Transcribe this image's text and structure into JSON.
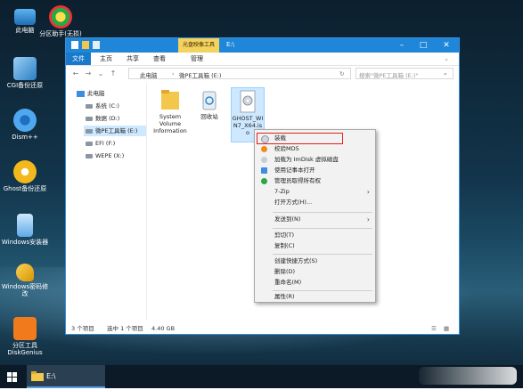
{
  "desktop": {
    "icons": [
      {
        "label": "此电脑",
        "icon": "computer-icon"
      },
      {
        "label": "分区助手(无损)",
        "icon": "partition-assistant-icon"
      },
      {
        "label": "CGI备份还原",
        "icon": "cgi-backup-icon"
      },
      {
        "label": "Dism++",
        "icon": "dism-gear-icon"
      },
      {
        "label": "Ghost备份还原",
        "icon": "ghost-icon"
      },
      {
        "label": "Windows安装器",
        "icon": "windows-installer-icon"
      },
      {
        "label": "Windows密码修改",
        "icon": "key-icon"
      },
      {
        "label": "分区工具DiskGenius",
        "icon": "diskgenius-icon"
      }
    ]
  },
  "taskbar": {
    "explorer_label": "E:\\"
  },
  "window": {
    "title": "E:\\",
    "context_tab": "光盘映像工具",
    "ribbon_tabs": [
      "文件",
      "主页",
      "共享",
      "查看",
      "管理"
    ],
    "address": {
      "root": "此电脑",
      "current": "微PE工具箱 (E:)"
    },
    "search_placeholder": "搜索\"微PE工具箱 (E:)\"",
    "nav": [
      {
        "label": "此电脑",
        "icon": "computer-icon"
      },
      {
        "label": "系统 (C:)",
        "icon": "drive-icon"
      },
      {
        "label": "数据 (D:)",
        "icon": "drive-icon"
      },
      {
        "label": "微PE工具箱 (E:)",
        "icon": "drive-icon"
      },
      {
        "label": "EFI (F:)",
        "icon": "drive-icon"
      },
      {
        "label": "WEPE (X:)",
        "icon": "drive-icon"
      }
    ],
    "files": [
      {
        "name": "System Volume Information",
        "icon": "folder-icon"
      },
      {
        "name": "回收站",
        "icon": "recycle-bin-icon"
      },
      {
        "name": "GHOST_WIN7_X64.iso",
        "icon": "disc-image-icon"
      }
    ],
    "status": {
      "count": "3 个项目",
      "selected": "选中 1 个项目",
      "size": "4.40 GB"
    }
  },
  "context_menu": {
    "items": [
      {
        "label": "装载",
        "icon": "disc-icon"
      },
      {
        "label": "校验MD5",
        "icon": "md5-icon"
      },
      {
        "label": "加载为 ImDisk 虚拟磁盘",
        "icon": "imdisk-icon"
      },
      {
        "label": "使用记事本打开",
        "icon": "notepad-icon"
      },
      {
        "label": "管理员取得所有权",
        "icon": "shield-icon"
      },
      {
        "label": "7-Zip",
        "icon": ""
      },
      {
        "label": "打开方式(H)...",
        "icon": ""
      },
      {
        "label": "发送到(N)",
        "icon": ""
      },
      {
        "label": "剪切(T)",
        "icon": ""
      },
      {
        "label": "复制(C)",
        "icon": ""
      },
      {
        "label": "创建快捷方式(S)",
        "icon": ""
      },
      {
        "label": "删除(D)",
        "icon": ""
      },
      {
        "label": "重命名(M)",
        "icon": ""
      },
      {
        "label": "属性(R)",
        "icon": ""
      }
    ]
  },
  "colors": {
    "accent": "#1f86da",
    "highlight_border": "#e02020",
    "context_tab": "#f4d25e"
  }
}
